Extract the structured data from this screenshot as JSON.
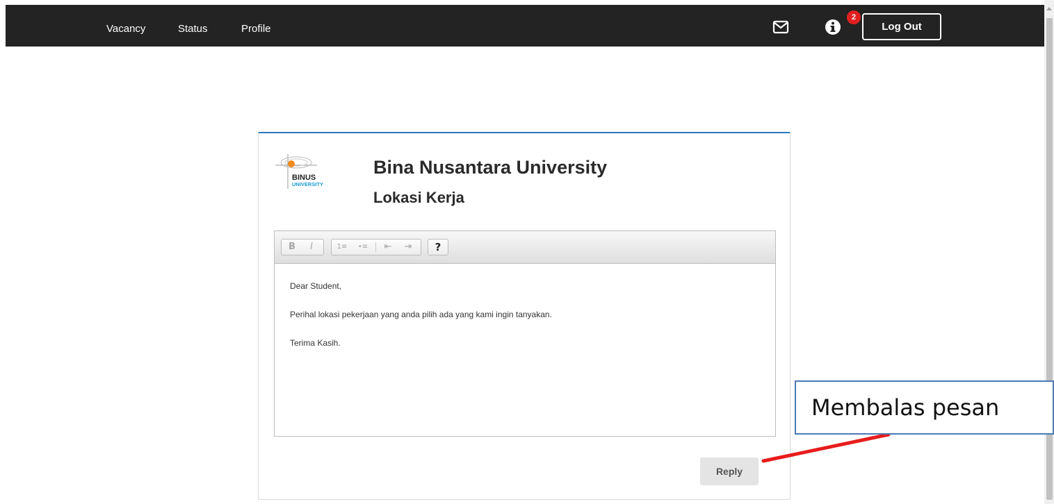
{
  "nav": {
    "links": [
      "Vacancy",
      "Status",
      "Profile"
    ],
    "notification_count": "2",
    "logout_label": "Log Out"
  },
  "message": {
    "logo_text": [
      "BINUS",
      "UNIVERSITY"
    ],
    "sender": "Bina Nusantara University",
    "subject": "Lokasi Kerja",
    "lines": [
      "Dear Student,",
      "Perihal lokasi pekerjaan yang anda pilih ada yang kami ingin tanyakan.",
      "Terima Kasih."
    ],
    "reply_label": "Reply"
  },
  "toolbar": {
    "bold": "B",
    "italic": "I",
    "ordered_list": "1≡",
    "unordered_list": "•≡",
    "outdent": "⇤",
    "indent": "⇥",
    "help": "?"
  },
  "annotation": {
    "callout_text": "Membalas pesan",
    "arrow_color": "#e81c1c"
  },
  "colors": {
    "topbar": "#232323",
    "card_accent": "#2a78b8",
    "badge": "#e22020"
  }
}
